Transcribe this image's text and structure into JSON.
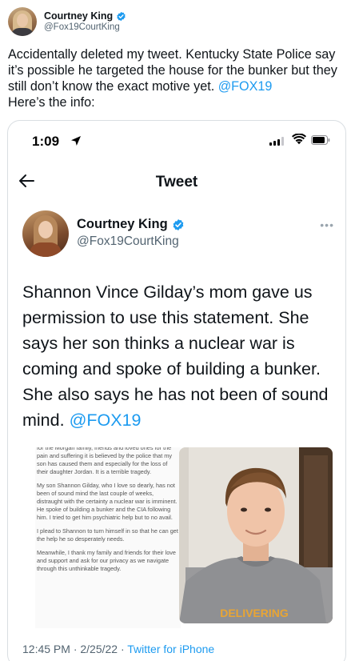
{
  "outer_tweet": {
    "author_name": "Courtney King",
    "author_handle": "@Fox19CourtKing",
    "text": "Accidentally deleted my tweet. Kentucky State Police say it’s possible he targeted the house for the bunker but they still don’t know the exact motive yet. ",
    "mention": "@FOX19",
    "text_end": "Here’s the info:"
  },
  "screenshot": {
    "status_bar": {
      "time": "1:09"
    },
    "nav": {
      "title": "Tweet"
    },
    "tweet": {
      "author_name": "Courtney King",
      "author_handle": "@Fox19CourtKing",
      "more": "•••",
      "text": "Shannon Vince Gilday’s mom gave us permission to use this statement. She says her son thinks a nuclear war is coming and spoke of building a bunker. She also says he has not been of sound mind. ",
      "mention": "@FOX19",
      "timestamp": "12:45 PM · 2/25/22 · ",
      "source": "Twitter for iPhone"
    },
    "letter": {
      "p1": "for the Morgan family, friends and loved ones for the pain and suffering it is believed by the police that my son has caused them and especially for the loss of their daughter Jordan.  It is a terrible tragedy.",
      "p2": "My son Shannon Gilday, who I love so dearly, has not been of sound mind the last couple of weeks, distraught with the certainty a nuclear war is imminent.  He spoke of building a bunker and the CIA following him.  I tried to get him psychiatric help but to no avail.",
      "p3": "I plead to Shannon to turn himself in so that he can get the help he so desperately needs.",
      "p4": "Meanwhile, I thank my family and friends for their love and support and ask for our privacy as we navigate through this unthinkable tragedy."
    },
    "photo": {
      "shirt_text": "DELIVERING"
    }
  },
  "colors": {
    "link": "#1d9bf0",
    "secondary_text": "#536471",
    "verified": "#1d9bf0"
  }
}
